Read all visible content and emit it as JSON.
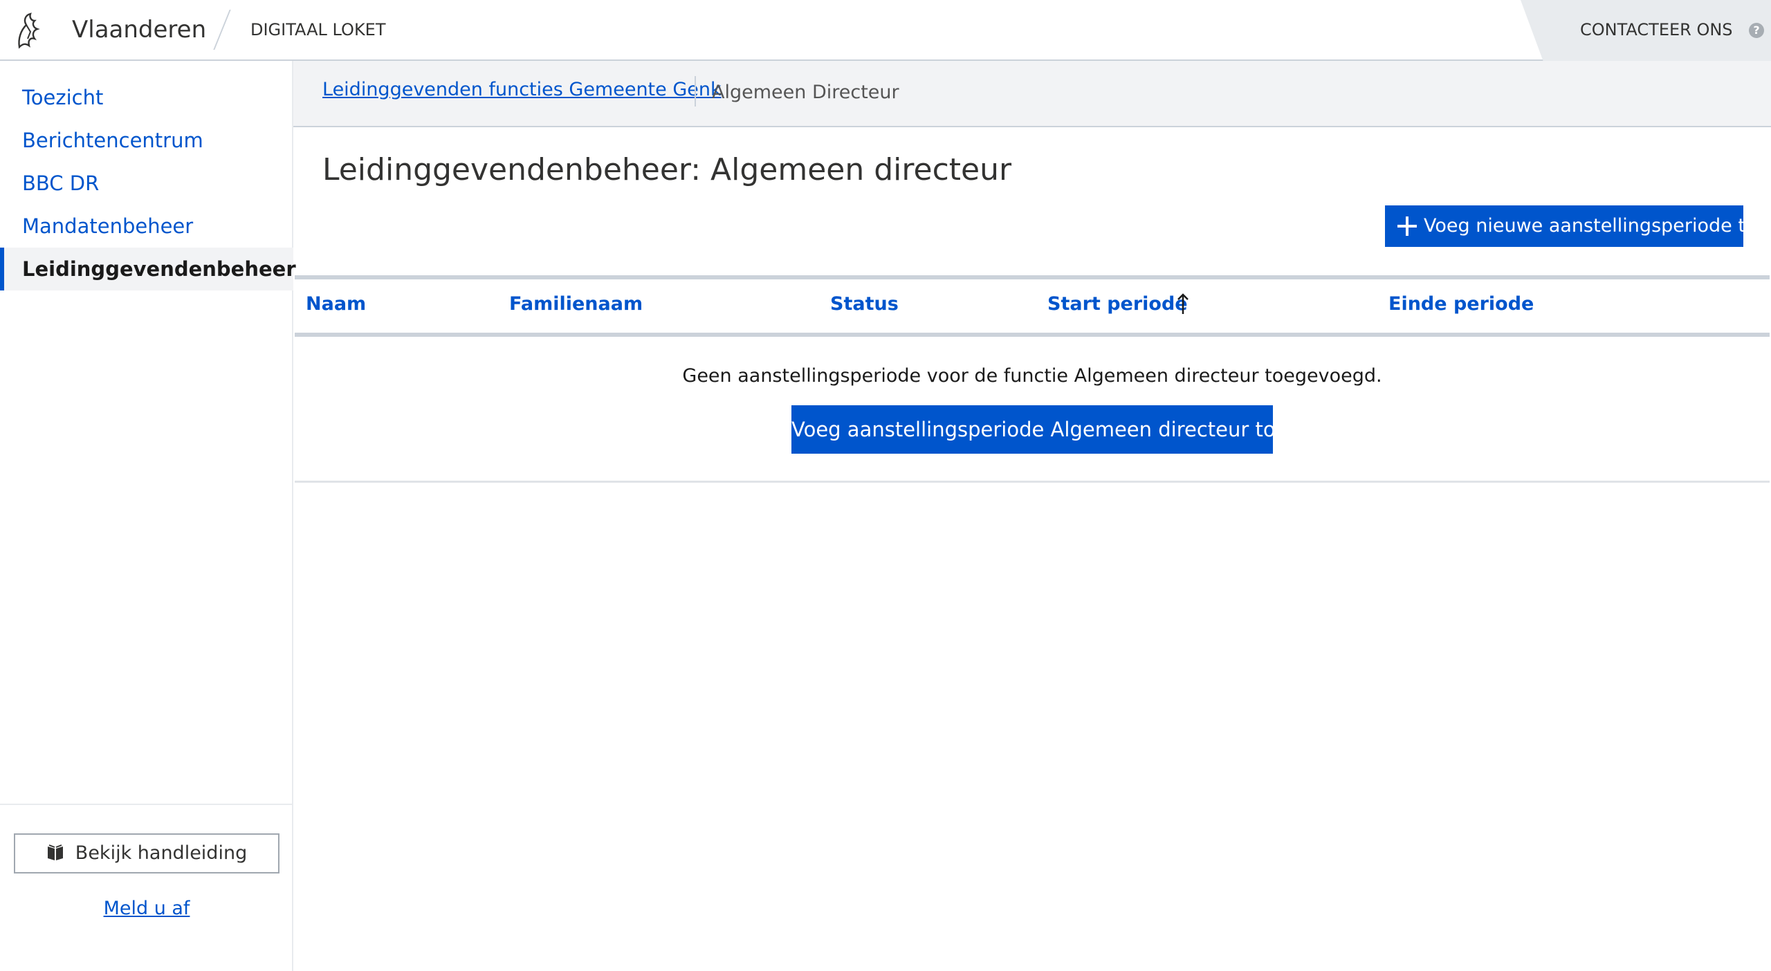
{
  "header": {
    "brand": "Vlaanderen",
    "app_name": "DIGITAAL LOKET",
    "contact_label": "CONTACTEER ONS",
    "help_icon": "?"
  },
  "sidebar": {
    "items": [
      {
        "label": "Toezicht",
        "active": false
      },
      {
        "label": "Berichtencentrum",
        "active": false
      },
      {
        "label": "BBC DR",
        "active": false
      },
      {
        "label": "Mandatenbeheer",
        "active": false
      },
      {
        "label": "Leidinggevendenbeheer",
        "active": true
      }
    ],
    "manual_button": "Bekijk handleiding",
    "logout": "Meld u af"
  },
  "breadcrumb": {
    "parent": "Leidinggevenden functies Gemeente Genk",
    "current": "Algemeen Directeur"
  },
  "main": {
    "title": "Leidinggevendenbeheer: Algemeen directeur",
    "add_button": "Voeg nieuwe aanstellingsperiode toe",
    "table": {
      "columns": [
        "Naam",
        "Familienaam",
        "Status",
        "Start periode",
        "Einde periode"
      ],
      "sorted_column": "Start periode",
      "sort_direction": "ascending"
    },
    "empty_message": "Geen aanstellingsperiode voor de functie Algemeen directeur toegevoegd.",
    "empty_add_button": "Voeg aanstellingsperiode Algemeen directeur toe"
  },
  "colors": {
    "accent": "#0055cc",
    "nav_active_bg": "#f2f3f5",
    "contact_bg": "#e8ebee"
  },
  "icons": {
    "logo": "flemish-lion-icon",
    "help": "help-icon",
    "manual": "book-icon",
    "add": "plus-icon",
    "sort": "sort-ascending-icon"
  }
}
